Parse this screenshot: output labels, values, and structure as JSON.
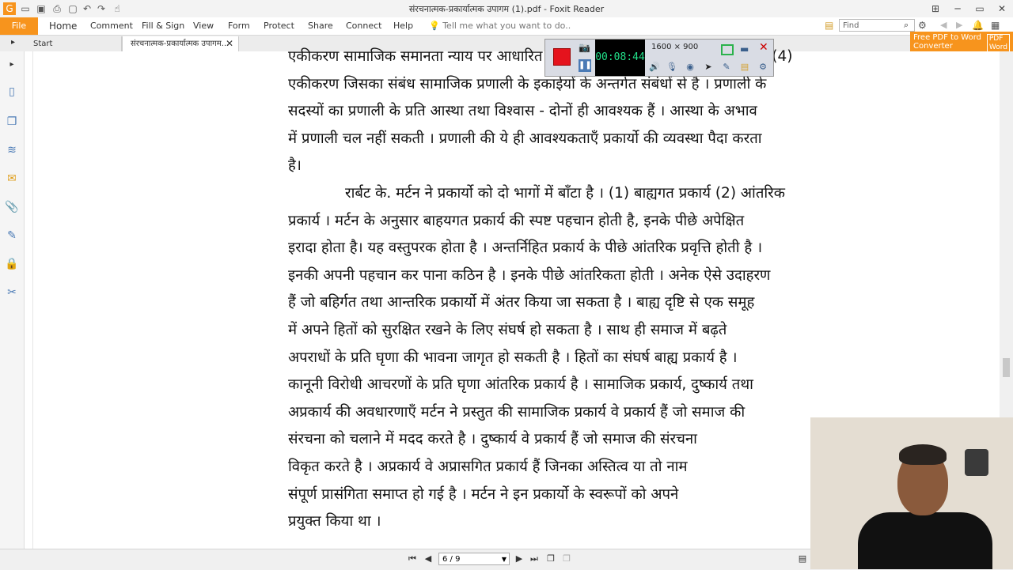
{
  "app": {
    "title": "संरचनात्मक-प्रकार्यात्मक उपागम (1).pdf - Foxit Reader"
  },
  "ribbon": {
    "file_label": "File",
    "tabs": [
      "Home",
      "Comment",
      "Fill & Sign",
      "View",
      "Form",
      "Protect",
      "Share",
      "Connect",
      "Help"
    ],
    "tell_me": "Tell me what you want to do..",
    "find_placeholder": "Find",
    "promo_line1": "Free PDF to Word",
    "promo_line2": "Converter",
    "promo_badge_1": "PDF",
    "promo_badge_2": "Word"
  },
  "doc_tabs": {
    "start": "Start",
    "document": "संरचनात्मक-प्रकार्यात्मक उपागम..."
  },
  "document": {
    "lines": [
      "एकीकरण सामाजिक समानता न्याय पर आधारित होते हैं । (3) वस्तुपरक कहे जा सकते हैं । (4)",
      "एकीकरण जिसका संबंध सामाजिक प्रणाली के इकाईयों के अन्तर्गत संबंधों से है । प्रणाली के",
      "सदस्यों का प्रणाली के प्रति आस्था तथा विश्वास  - दोनों ही आवश्यक हैं । आस्था के अभाव",
      "में प्रणाली चल नहीं सकती । प्रणाली की ये ही आवश्यकताएँ प्रकार्यो की व्यवस्था पैदा करता",
      "है।",
      "रार्बट के. मर्टन ने प्रकार्यो को दो भागों में बाँटा है । (1) बाह्यगत प्रकार्य (2) आंतरिक",
      "प्रकार्य । मर्टन के अनुसार बाहयगत प्रकार्य की स्पष्ट पहचान होती है, इनके पीछे अपेक्षित",
      "इरादा होता है। यह वस्तुपरक होता है । अन्तर्निहित प्रकार्य के पीछे आंतरिक प्रवृत्ति होती है ।",
      "इनकी अपनी पहचान कर पाना कठिन है । इनके पीछे आंतरिकता होती । अनेक ऐसे उदाहरण",
      "हैं जो बहिर्गत तथा आन्तरिक प्रकार्यो में अंतर किया जा सकता है । बाह्य दृष्टि से एक समूह",
      "में अपने हितों को सुरक्षित रखने के लिए संघर्ष हो सकता है । साथ ही समाज में बढ़ते",
      "अपराधों के प्रति घृणा की भावना जागृत हो सकती है । हितों का संघर्ष बाह्य प्रकार्य है ।",
      "कानूनी विरोधी आचरणों के प्रति घृणा आंतरिक प्रकार्य है । सामाजिक प्रकार्य, दुष्कार्य तथा",
      "अप्रकार्य की अवधारणाएँ मर्टन ने प्रस्तुत की सामाजिक प्रकार्य वे प्रकार्य हैं जो समाज की",
      "संरचना को चलाने में मदद करते है । दुष्कार्य वे प्रकार्य हैं जो समाज की संरचना",
      "विकृत करते है । अप्रकार्य वे अप्रासगित प्रकार्य हैं जिनका अस्तित्व या तो नाम",
      "संपूर्ण प्रासंगिता समाप्त हो गई है । मर्टन ने इन प्रकार्यो के स्वरूपों को अपने",
      "प्रयुक्त किया था ।"
    ]
  },
  "statusbar": {
    "page_indicator": "6 / 9"
  },
  "recorder": {
    "timer": "00:08:44",
    "resolution": "1600 × 900"
  },
  "colors": {
    "file_tab": "#f7941d",
    "record": "#e5131d",
    "timer_text": "#22e08a"
  }
}
